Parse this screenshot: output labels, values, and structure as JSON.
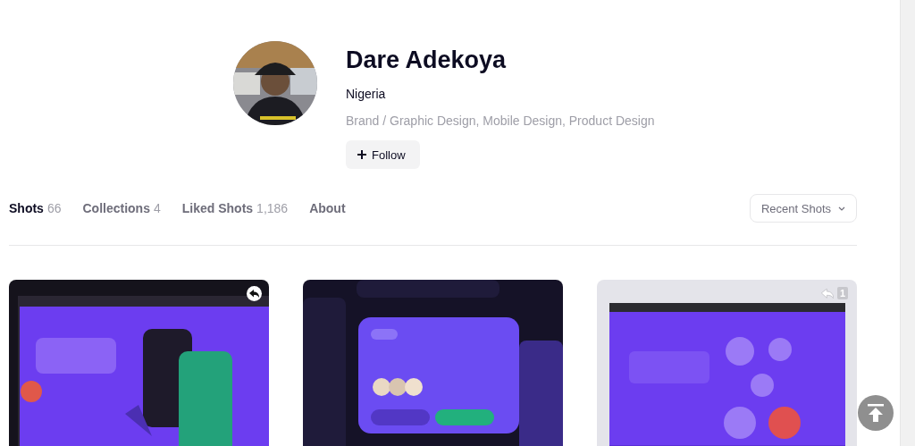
{
  "profile": {
    "name": "Dare Adekoya",
    "location": "Nigeria",
    "skills": "Brand / Graphic Design, Mobile Design, Product Design",
    "follow_button": "Follow"
  },
  "tabs": [
    {
      "label": "Shots",
      "count": "66",
      "selected": true
    },
    {
      "label": "Collections",
      "count": "4",
      "selected": false
    },
    {
      "label": "Liked Shots",
      "count": "1,186",
      "selected": false
    },
    {
      "label": "About",
      "selected": false
    }
  ],
  "sort_dropdown": {
    "value": "Recent Shots"
  },
  "shots": [
    {
      "kind": "picture",
      "rebound": true
    },
    {
      "kind": "picture",
      "rebound": false
    },
    {
      "kind": "picture",
      "rebound": true,
      "rebound_count": "1"
    }
  ]
}
